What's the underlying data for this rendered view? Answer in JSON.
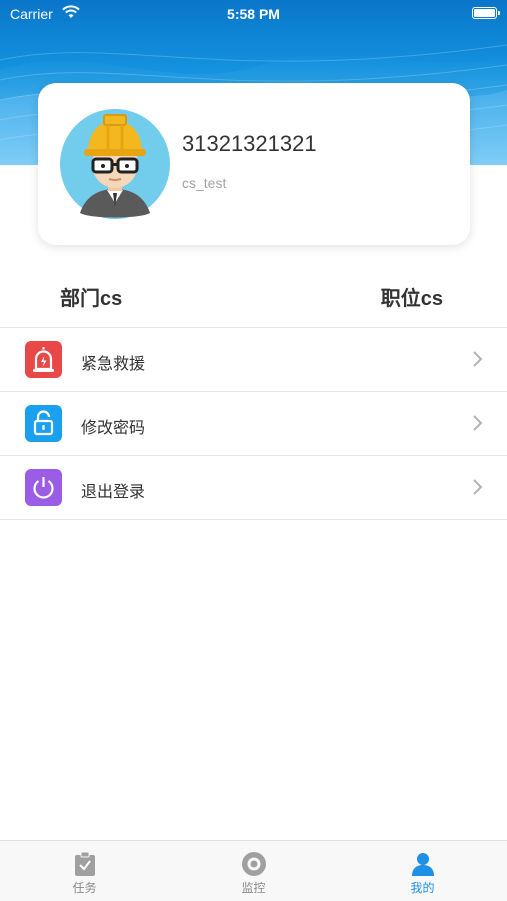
{
  "status_bar": {
    "carrier": "Carrier",
    "time": "5:58 PM"
  },
  "profile": {
    "username": "31321321321",
    "account": "cs_test"
  },
  "info": {
    "department": "部门cs",
    "position": "职位cs"
  },
  "menu": [
    {
      "label": "紧急救援",
      "icon": "alarm-icon",
      "color": "#e84848"
    },
    {
      "label": "修改密码",
      "icon": "lock-icon",
      "color": "#1aa0ee"
    },
    {
      "label": "退出登录",
      "icon": "power-icon",
      "color": "#9b5de5"
    }
  ],
  "tabbar": [
    {
      "label": "任务",
      "icon": "clipboard-icon",
      "active": false
    },
    {
      "label": "监控",
      "icon": "camera-icon",
      "active": false
    },
    {
      "label": "我的",
      "icon": "user-icon",
      "active": true
    }
  ],
  "colors": {
    "accent": "#1e90e6",
    "header": "#0a76c9"
  }
}
